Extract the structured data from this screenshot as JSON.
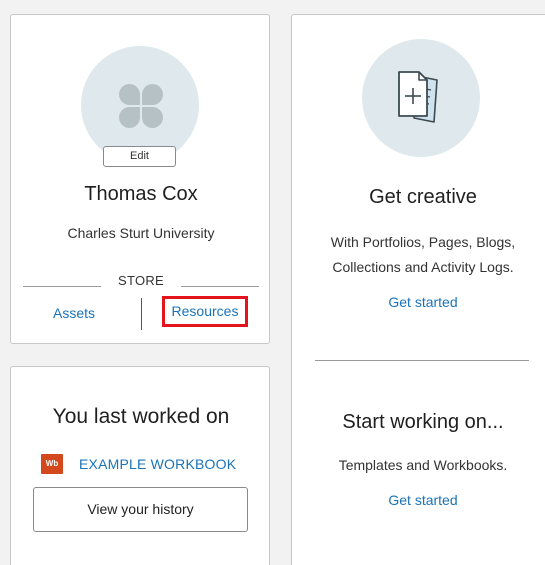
{
  "profile": {
    "edit_label": "Edit",
    "name": "Thomas Cox",
    "organization": "Charles Sturt University",
    "store_label": "STORE",
    "assets_label": "Assets",
    "resources_label": "Resources",
    "highlight_color": "#e3141b"
  },
  "history": {
    "title": "You last worked on",
    "workbook_badge": "Wb",
    "workbook_name": "EXAMPLE WORKBOOK",
    "view_history_label": "View your history"
  },
  "create": {
    "title": "Get creative",
    "desc_line1": "With Portfolios, Pages, Blogs,",
    "desc_line2": "Collections and Activity Logs.",
    "link_label": "Get started"
  },
  "start": {
    "title": "Start working on...",
    "desc": "Templates and Workbooks.",
    "link_label": "Get started"
  },
  "colors": {
    "link": "#1a73b8",
    "workbook_badge": "#d4481d",
    "icon_circle": "#dfe8ec"
  }
}
